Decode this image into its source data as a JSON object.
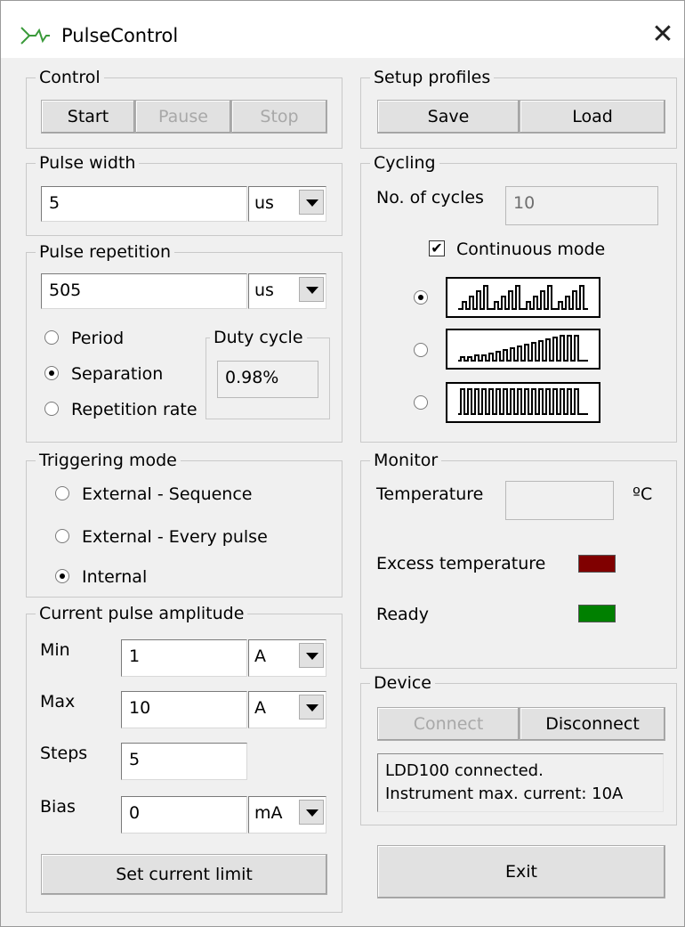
{
  "window": {
    "title": "PulseControl",
    "logo_icon": "pulse-logo-icon",
    "close_glyph": "✕"
  },
  "control": {
    "title": "Control",
    "start": "Start",
    "pause": "Pause",
    "stop": "Stop"
  },
  "setup_profiles": {
    "title": "Setup profiles",
    "save": "Save",
    "load": "Load"
  },
  "pulse_width": {
    "title": "Pulse width",
    "value": "5",
    "unit": "us"
  },
  "cycling": {
    "title": "Cycling",
    "cycles_label": "No. of cycles",
    "cycles_value": "10",
    "continuous_label": "Continuous mode",
    "continuous_checked": true,
    "checkmark": "✔",
    "selected_pattern": 0,
    "patterns": [
      "grouped-ramp-pattern",
      "single-ramp-pattern",
      "constant-pattern"
    ]
  },
  "pulse_repetition": {
    "title": "Pulse repetition",
    "value": "505",
    "unit": "us",
    "options": [
      "Period",
      "Separation",
      "Repetition rate"
    ],
    "selected": 1,
    "duty_cycle_title": "Duty cycle",
    "duty_cycle_value": "0.98%"
  },
  "triggering_mode": {
    "title": "Triggering mode",
    "options": [
      "External - Sequence",
      "External - Every pulse",
      "Internal"
    ],
    "selected": 2
  },
  "monitor": {
    "title": "Monitor",
    "temperature_label": "Temperature",
    "temperature_value": "",
    "temperature_unit": "ºC",
    "excess_label": "Excess temperature",
    "excess_color": "#800000",
    "ready_label": "Ready",
    "ready_color": "#008000"
  },
  "current_amplitude": {
    "title": "Current pulse amplitude",
    "min_label": "Min",
    "min_value": "1",
    "min_unit": "A",
    "max_label": "Max",
    "max_value": "10",
    "max_unit": "A",
    "steps_label": "Steps",
    "steps_value": "5",
    "bias_label": "Bias",
    "bias_value": "0",
    "bias_unit": "mA",
    "set_limit": "Set current limit"
  },
  "device": {
    "title": "Device",
    "connect": "Connect",
    "disconnect": "Disconnect",
    "status_line1": "LDD100 connected.",
    "status_line2": "Instrument max. current: 10A"
  },
  "exit": "Exit"
}
